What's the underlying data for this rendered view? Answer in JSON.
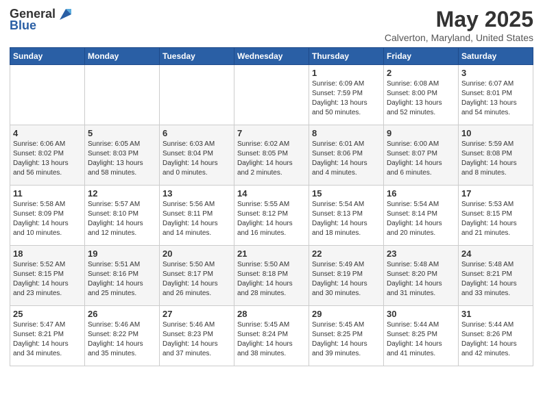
{
  "logo": {
    "general": "General",
    "blue": "Blue"
  },
  "title": "May 2025",
  "subtitle": "Calverton, Maryland, United States",
  "weekdays": [
    "Sunday",
    "Monday",
    "Tuesday",
    "Wednesday",
    "Thursday",
    "Friday",
    "Saturday"
  ],
  "weeks": [
    [
      {
        "day": "",
        "info": ""
      },
      {
        "day": "",
        "info": ""
      },
      {
        "day": "",
        "info": ""
      },
      {
        "day": "",
        "info": ""
      },
      {
        "day": "1",
        "info": "Sunrise: 6:09 AM\nSunset: 7:59 PM\nDaylight: 13 hours\nand 50 minutes."
      },
      {
        "day": "2",
        "info": "Sunrise: 6:08 AM\nSunset: 8:00 PM\nDaylight: 13 hours\nand 52 minutes."
      },
      {
        "day": "3",
        "info": "Sunrise: 6:07 AM\nSunset: 8:01 PM\nDaylight: 13 hours\nand 54 minutes."
      }
    ],
    [
      {
        "day": "4",
        "info": "Sunrise: 6:06 AM\nSunset: 8:02 PM\nDaylight: 13 hours\nand 56 minutes."
      },
      {
        "day": "5",
        "info": "Sunrise: 6:05 AM\nSunset: 8:03 PM\nDaylight: 13 hours\nand 58 minutes."
      },
      {
        "day": "6",
        "info": "Sunrise: 6:03 AM\nSunset: 8:04 PM\nDaylight: 14 hours\nand 0 minutes."
      },
      {
        "day": "7",
        "info": "Sunrise: 6:02 AM\nSunset: 8:05 PM\nDaylight: 14 hours\nand 2 minutes."
      },
      {
        "day": "8",
        "info": "Sunrise: 6:01 AM\nSunset: 8:06 PM\nDaylight: 14 hours\nand 4 minutes."
      },
      {
        "day": "9",
        "info": "Sunrise: 6:00 AM\nSunset: 8:07 PM\nDaylight: 14 hours\nand 6 minutes."
      },
      {
        "day": "10",
        "info": "Sunrise: 5:59 AM\nSunset: 8:08 PM\nDaylight: 14 hours\nand 8 minutes."
      }
    ],
    [
      {
        "day": "11",
        "info": "Sunrise: 5:58 AM\nSunset: 8:09 PM\nDaylight: 14 hours\nand 10 minutes."
      },
      {
        "day": "12",
        "info": "Sunrise: 5:57 AM\nSunset: 8:10 PM\nDaylight: 14 hours\nand 12 minutes."
      },
      {
        "day": "13",
        "info": "Sunrise: 5:56 AM\nSunset: 8:11 PM\nDaylight: 14 hours\nand 14 minutes."
      },
      {
        "day": "14",
        "info": "Sunrise: 5:55 AM\nSunset: 8:12 PM\nDaylight: 14 hours\nand 16 minutes."
      },
      {
        "day": "15",
        "info": "Sunrise: 5:54 AM\nSunset: 8:13 PM\nDaylight: 14 hours\nand 18 minutes."
      },
      {
        "day": "16",
        "info": "Sunrise: 5:54 AM\nSunset: 8:14 PM\nDaylight: 14 hours\nand 20 minutes."
      },
      {
        "day": "17",
        "info": "Sunrise: 5:53 AM\nSunset: 8:15 PM\nDaylight: 14 hours\nand 21 minutes."
      }
    ],
    [
      {
        "day": "18",
        "info": "Sunrise: 5:52 AM\nSunset: 8:15 PM\nDaylight: 14 hours\nand 23 minutes."
      },
      {
        "day": "19",
        "info": "Sunrise: 5:51 AM\nSunset: 8:16 PM\nDaylight: 14 hours\nand 25 minutes."
      },
      {
        "day": "20",
        "info": "Sunrise: 5:50 AM\nSunset: 8:17 PM\nDaylight: 14 hours\nand 26 minutes."
      },
      {
        "day": "21",
        "info": "Sunrise: 5:50 AM\nSunset: 8:18 PM\nDaylight: 14 hours\nand 28 minutes."
      },
      {
        "day": "22",
        "info": "Sunrise: 5:49 AM\nSunset: 8:19 PM\nDaylight: 14 hours\nand 30 minutes."
      },
      {
        "day": "23",
        "info": "Sunrise: 5:48 AM\nSunset: 8:20 PM\nDaylight: 14 hours\nand 31 minutes."
      },
      {
        "day": "24",
        "info": "Sunrise: 5:48 AM\nSunset: 8:21 PM\nDaylight: 14 hours\nand 33 minutes."
      }
    ],
    [
      {
        "day": "25",
        "info": "Sunrise: 5:47 AM\nSunset: 8:21 PM\nDaylight: 14 hours\nand 34 minutes."
      },
      {
        "day": "26",
        "info": "Sunrise: 5:46 AM\nSunset: 8:22 PM\nDaylight: 14 hours\nand 35 minutes."
      },
      {
        "day": "27",
        "info": "Sunrise: 5:46 AM\nSunset: 8:23 PM\nDaylight: 14 hours\nand 37 minutes."
      },
      {
        "day": "28",
        "info": "Sunrise: 5:45 AM\nSunset: 8:24 PM\nDaylight: 14 hours\nand 38 minutes."
      },
      {
        "day": "29",
        "info": "Sunrise: 5:45 AM\nSunset: 8:25 PM\nDaylight: 14 hours\nand 39 minutes."
      },
      {
        "day": "30",
        "info": "Sunrise: 5:44 AM\nSunset: 8:25 PM\nDaylight: 14 hours\nand 41 minutes."
      },
      {
        "day": "31",
        "info": "Sunrise: 5:44 AM\nSunset: 8:26 PM\nDaylight: 14 hours\nand 42 minutes."
      }
    ]
  ]
}
